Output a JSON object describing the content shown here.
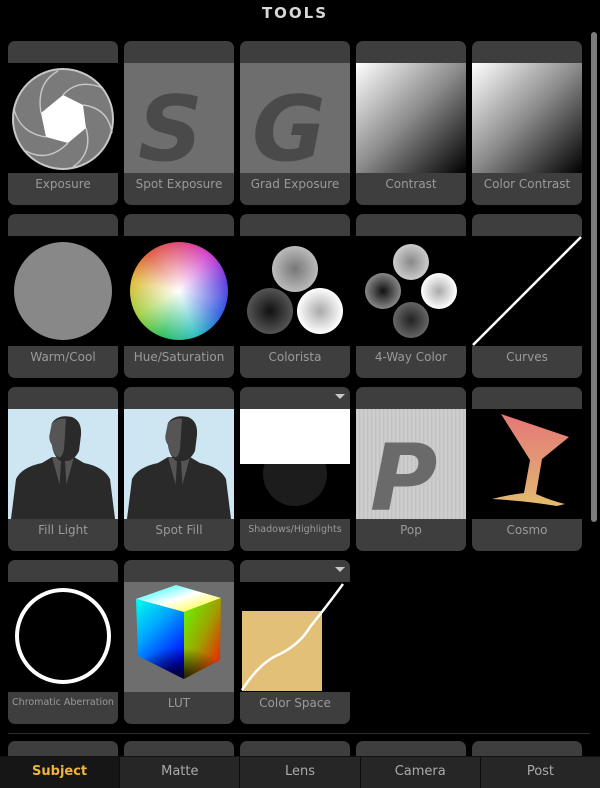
{
  "title": "TOOLS",
  "tiles": [
    {
      "label": "Exposure",
      "icon": "aperture-icon",
      "has_dropdown": false
    },
    {
      "label": "Spot Exposure",
      "icon": "letter-s-icon",
      "has_dropdown": false
    },
    {
      "label": "Grad Exposure",
      "icon": "letter-g-icon",
      "has_dropdown": false
    },
    {
      "label": "Contrast",
      "icon": "gradient-square-icon",
      "has_dropdown": false
    },
    {
      "label": "Color Contrast",
      "icon": "gradient-square-icon",
      "has_dropdown": false
    },
    {
      "label": "Warm/Cool",
      "icon": "gray-circle-icon",
      "has_dropdown": false
    },
    {
      "label": "Hue/Saturation",
      "icon": "color-wheel-icon",
      "has_dropdown": false
    },
    {
      "label": "Colorista",
      "icon": "three-wheels-icon",
      "has_dropdown": false
    },
    {
      "label": "4-Way Color",
      "icon": "four-wheels-icon",
      "has_dropdown": false
    },
    {
      "label": "Curves",
      "icon": "diagonal-line-icon",
      "has_dropdown": false
    },
    {
      "label": "Fill Light",
      "icon": "man-silhouette-icon",
      "has_dropdown": false
    },
    {
      "label": "Spot Fill",
      "icon": "man-silhouette-icon",
      "has_dropdown": false
    },
    {
      "label": "Shadows/Highlights",
      "icon": "shadows-highlights-icon",
      "has_dropdown": true
    },
    {
      "label": "Pop",
      "icon": "letter-p-icon",
      "has_dropdown": false
    },
    {
      "label": "Cosmo",
      "icon": "cocktail-glass-icon",
      "has_dropdown": false
    },
    {
      "label": "Chromatic Aberration",
      "icon": "ring-icon",
      "has_dropdown": false
    },
    {
      "label": "LUT",
      "icon": "color-cube-icon",
      "has_dropdown": false
    },
    {
      "label": "Color Space",
      "icon": "color-space-curve-icon",
      "has_dropdown": true
    }
  ],
  "glyphs": {
    "s": "S",
    "g": "G",
    "p": "P"
  },
  "tabs": [
    {
      "label": "Subject",
      "active": true
    },
    {
      "label": "Matte",
      "active": false
    },
    {
      "label": "Lens",
      "active": false
    },
    {
      "label": "Camera",
      "active": false
    },
    {
      "label": "Post",
      "active": false
    }
  ],
  "colors": {
    "active_tab": "#f0b43a",
    "tile_bg": "#3e3e3e",
    "label_text": "#9a9a9a",
    "fill_light_sky": "#cde6f2",
    "color_space_square": "#e2c077",
    "cosmo_top": "#e47777",
    "cosmo_bottom": "#e3bc6e"
  }
}
